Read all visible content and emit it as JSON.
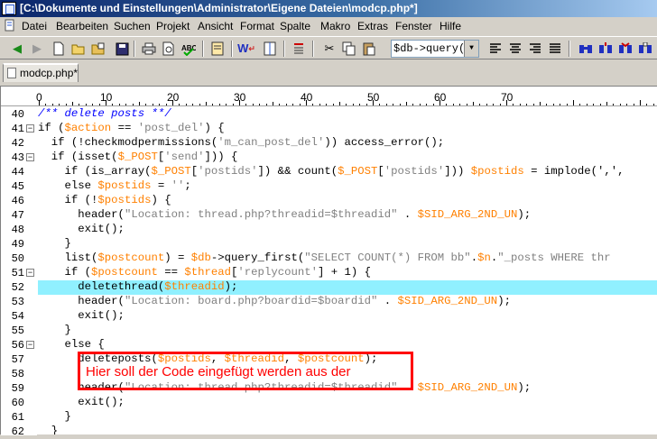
{
  "window": {
    "title": "[C:\\Dokumente und Einstellungen\\Administrator\\Eigene Dateien\\modcp.php*]"
  },
  "menu": [
    "Datei",
    "Bearbeiten",
    "Suchen",
    "Projekt",
    "Ansicht",
    "Format",
    "Spalte",
    "Makro",
    "Extras",
    "Fenster",
    "Hilfe"
  ],
  "toolbar": {
    "combo_value": "$db->query(\"DE"
  },
  "tabs": [
    "modcp.php*"
  ],
  "ruler": {
    "labels": [
      "0",
      "10",
      "20",
      "30",
      "40",
      "50",
      "60",
      "70"
    ]
  },
  "colors": {
    "comment": "#0000ff",
    "variable": "#ff8000",
    "string": "#808080",
    "highlight": "#90f0ff",
    "annotation": "#ff0000"
  },
  "editor": {
    "line_numbers": [
      "40",
      "41",
      "42",
      "43",
      "44",
      "45",
      "46",
      "47",
      "48",
      "49",
      "50",
      "51",
      "52",
      "53",
      "54",
      "55",
      "56",
      "57",
      "58",
      "59",
      "60",
      "61",
      "62"
    ],
    "lines": [
      [
        {
          "t": "/** delete posts **/",
          "c": "cm"
        }
      ],
      [
        {
          "t": "if ("
        },
        {
          "t": "$action",
          "c": "vr"
        },
        {
          "t": " == "
        },
        {
          "t": "'post_del'",
          "c": "st"
        },
        {
          "t": ") {"
        }
      ],
      [
        {
          "t": "  if (!checkmodpermissions("
        },
        {
          "t": "'m_can_post_del'",
          "c": "st"
        },
        {
          "t": ")) access_error();"
        }
      ],
      [
        {
          "t": "  if (isset("
        },
        {
          "t": "$_POST",
          "c": "vr"
        },
        {
          "t": "["
        },
        {
          "t": "'send'",
          "c": "st"
        },
        {
          "t": "])) {"
        }
      ],
      [
        {
          "t": "    if (is_array("
        },
        {
          "t": "$_POST",
          "c": "vr"
        },
        {
          "t": "["
        },
        {
          "t": "'postids'",
          "c": "st"
        },
        {
          "t": "]) && count("
        },
        {
          "t": "$_POST",
          "c": "vr"
        },
        {
          "t": "["
        },
        {
          "t": "'postids'",
          "c": "st"
        },
        {
          "t": "])) "
        },
        {
          "t": "$postids",
          "c": "vr"
        },
        {
          "t": " = implode(',',"
        }
      ],
      [
        {
          "t": "    else "
        },
        {
          "t": "$postids",
          "c": "vr"
        },
        {
          "t": " = "
        },
        {
          "t": "''",
          "c": "st"
        },
        {
          "t": ";"
        }
      ],
      [
        {
          "t": "    if (!"
        },
        {
          "t": "$postids",
          "c": "vr"
        },
        {
          "t": ") {"
        }
      ],
      [
        {
          "t": "      header("
        },
        {
          "t": "\"Location: thread.php?threadid=$threadid\"",
          "c": "st"
        },
        {
          "t": " . "
        },
        {
          "t": "$SID_ARG_2ND_UN",
          "c": "vr"
        },
        {
          "t": ");"
        }
      ],
      [
        {
          "t": "      exit();"
        }
      ],
      [
        {
          "t": "    }"
        }
      ],
      [
        {
          "t": "    list("
        },
        {
          "t": "$postcount",
          "c": "vr"
        },
        {
          "t": ") = "
        },
        {
          "t": "$db",
          "c": "vr"
        },
        {
          "t": "->query_first("
        },
        {
          "t": "\"SELECT COUNT(*) FROM bb\"",
          "c": "st"
        },
        {
          "t": "."
        },
        {
          "t": "$n",
          "c": "vr"
        },
        {
          "t": "."
        },
        {
          "t": "\"_posts WHERE thr",
          "c": "st"
        }
      ],
      [
        {
          "t": "    if ("
        },
        {
          "t": "$postcount",
          "c": "vr"
        },
        {
          "t": " == "
        },
        {
          "t": "$thread",
          "c": "vr"
        },
        {
          "t": "["
        },
        {
          "t": "'replycount'",
          "c": "st"
        },
        {
          "t": "] + 1) {"
        }
      ],
      [
        {
          "t": "      deletethread("
        },
        {
          "t": "$threadid",
          "c": "vr"
        },
        {
          "t": ");"
        }
      ],
      [
        {
          "t": "      header("
        },
        {
          "t": "\"Location: board.php?boardid=$boardid\"",
          "c": "st"
        },
        {
          "t": " . "
        },
        {
          "t": "$SID_ARG_2ND_UN",
          "c": "vr"
        },
        {
          "t": ");"
        }
      ],
      [
        {
          "t": "      exit();"
        }
      ],
      [
        {
          "t": "    }"
        }
      ],
      [
        {
          "t": "    else {"
        }
      ],
      [
        {
          "t": "      deleteposts("
        },
        {
          "t": "$postids",
          "c": "vr"
        },
        {
          "t": ", "
        },
        {
          "t": "$threadid",
          "c": "vr"
        },
        {
          "t": ", "
        },
        {
          "t": "$postcount",
          "c": "vr"
        },
        {
          "t": ");"
        }
      ],
      [
        {
          "t": ""
        }
      ],
      [
        {
          "t": "      header("
        },
        {
          "t": "\"Location: thread.php?threadid=$threadid\"",
          "c": "st"
        },
        {
          "t": " . "
        },
        {
          "t": "$SID_ARG_2ND_UN",
          "c": "vr"
        },
        {
          "t": ");"
        }
      ],
      [
        {
          "t": "      exit();"
        }
      ],
      [
        {
          "t": "    }"
        }
      ],
      [
        {
          "t": "  }"
        }
      ]
    ]
  },
  "annotation": {
    "text": "Hier soll der Code eingefügt werden aus der"
  }
}
